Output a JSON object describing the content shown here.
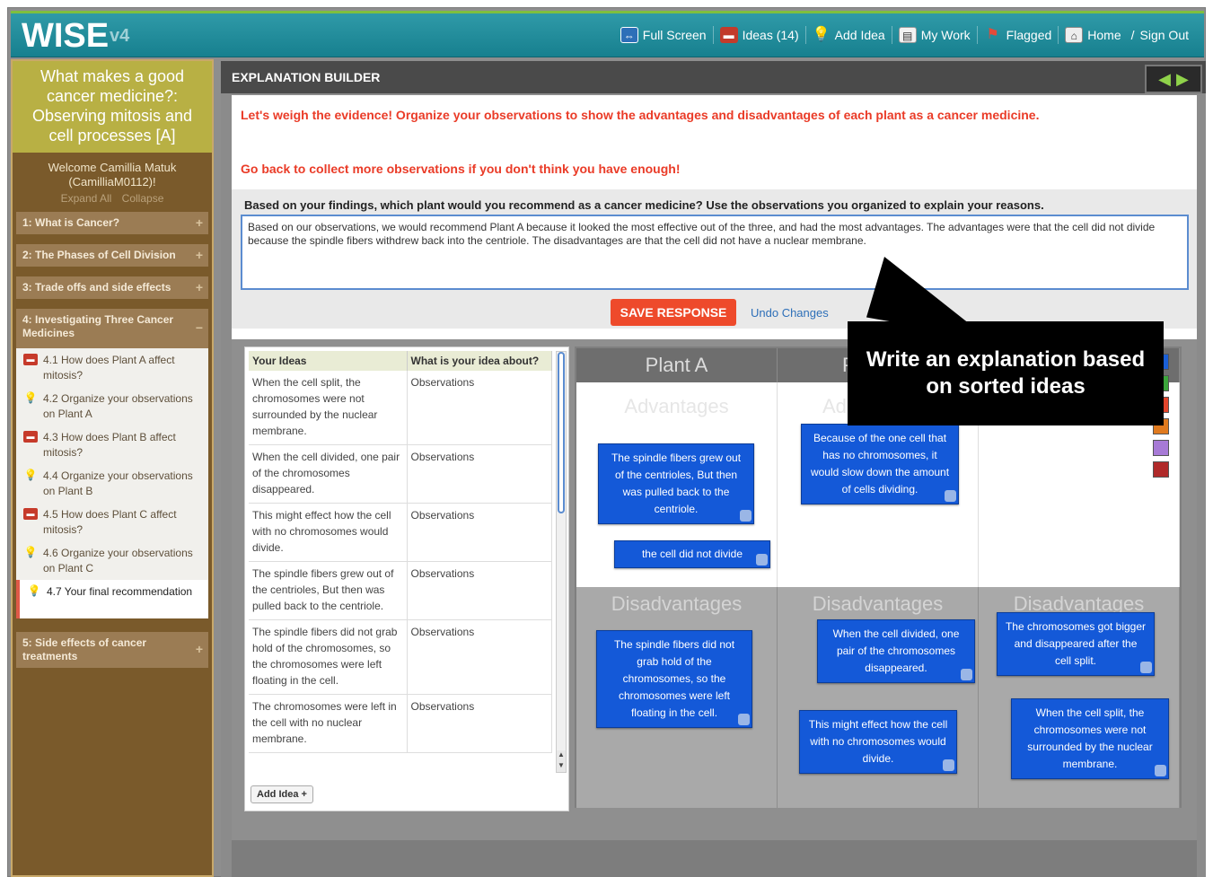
{
  "app": {
    "logo": "WISE",
    "version": "v4"
  },
  "topnav": [
    {
      "label": "Full Screen",
      "icon": "fullscreen-icon"
    },
    {
      "label": "Ideas (14)",
      "icon": "ideas-basket-icon"
    },
    {
      "label": "Add Idea",
      "icon": "lightbulb-icon"
    },
    {
      "label": "My Work",
      "icon": "notebook-icon"
    },
    {
      "label": "Flagged",
      "icon": "flag-icon"
    },
    {
      "label": "Home",
      "icon": "home-icon"
    },
    {
      "label": "Sign Out",
      "icon": ""
    }
  ],
  "sidebar": {
    "project_title": "What makes a good cancer medicine?: Observing mitosis and cell processes [A]",
    "welcome": "Welcome Camillia Matuk (CamilliaM0112)!",
    "expand_all": "Expand All",
    "collapse": "Collapse",
    "units": [
      {
        "label": "1: What is Cancer?"
      },
      {
        "label": "2: The Phases of Cell Division"
      },
      {
        "label": "3: Trade offs and side effects"
      },
      {
        "label": "4: Investigating Three Cancer Medicines"
      },
      {
        "label": "5: Side effects of cancer treatments"
      }
    ],
    "steps": [
      {
        "label": "4.1 How does Plant A affect mitosis?",
        "icon": "ideas-basket-icon"
      },
      {
        "label": "4.2 Organize your observations on Plant A",
        "icon": "lightbulb-icon"
      },
      {
        "label": "4.3 How does Plant B affect mitosis?",
        "icon": "ideas-basket-icon"
      },
      {
        "label": "4.4 Organize your observations on Plant B",
        "icon": "lightbulb-icon"
      },
      {
        "label": "4.5 How does Plant C affect mitosis?",
        "icon": "ideas-basket-icon"
      },
      {
        "label": "4.6 Organize your observations on Plant C",
        "icon": "lightbulb-icon"
      },
      {
        "label": "4.7 Your final recommendation",
        "icon": "lightbulb-icon"
      }
    ]
  },
  "main": {
    "header": "EXPLANATION BUILDER",
    "instruction1": "Let's weigh the evidence! Organize your observations to show the advantages and disadvantages of each plant as a cancer medicine.",
    "instruction2": "Go back to collect more observations if you don't think you have enough!",
    "prompt": "Based on your findings, which plant would you recommend as a cancer medicine? Use the observations you organized to explain your reasons.",
    "response": "Based on our observations, we would recommend Plant A because it looked the most effective out of the three, and had the most advantages. The advantages were that the cell did not divide because the spindle fibers withdrew back into the centriole. The disadvantages are that the cell did not have a nuclear membrane.",
    "save_label": "SAVE RESPONSE",
    "undo_label": "Undo Changes",
    "ideas_table": {
      "headers": [
        "Your Ideas",
        "What is your idea about?"
      ],
      "rows": [
        {
          "idea": "When the cell split, the chromosomes were not surrounded by the nuclear membrane.",
          "about": "Observations"
        },
        {
          "idea": "When the cell divided, one pair of the chromosomes disappeared.",
          "about": "Observations"
        },
        {
          "idea": "This might effect how the cell with no chromosomes would divide.",
          "about": "Observations"
        },
        {
          "idea": "The spindle fibers grew out of the centrioles, But then was pulled back to the centriole.",
          "about": "Observations"
        },
        {
          "idea": "The spindle fibers did not grab hold of the chromosomes, so the chromosomes were left floating in the cell.",
          "about": "Observations"
        },
        {
          "idea": "The chromosomes were left in the cell with no nuclear membrane.",
          "about": "Observations"
        }
      ]
    },
    "add_idea_label": "Add Idea +",
    "board": {
      "columns": [
        "Plant A",
        "P",
        ""
      ],
      "advantages_label": "Advantages",
      "advantages_label_b": "Ad",
      "disadvantages_label": "Disadvantages",
      "cards": {
        "a_adv_1": "The spindle fibers grew out of the centrioles, But then was pulled back to the centriole.",
        "a_adv_2": "the cell did not divide",
        "b_adv_1": "Because of the one cell that has no chromosomes, it would slow down the amount of cells dividing.",
        "a_dis_1": "The spindle fibers did not grab hold of the chromosomes, so the chromosomes were left floating in the cell.",
        "b_dis_1": "When the cell divided, one pair of the chromosomes disappeared.",
        "b_dis_2": "This might effect how the cell with no chromosomes would divide.",
        "c_dis_1": "The chromosomes got bigger and disappeared after the cell split.",
        "c_dis_2": "When the cell split, the chromosomes were not surrounded by the nuclear membrane."
      },
      "swatches": [
        "#1a5fd6",
        "#3ba53b",
        "#e2452c",
        "#e07a1e",
        "#a77ad6",
        "#b02a2a"
      ]
    },
    "callout": "Write an explanation based on sorted ideas"
  }
}
